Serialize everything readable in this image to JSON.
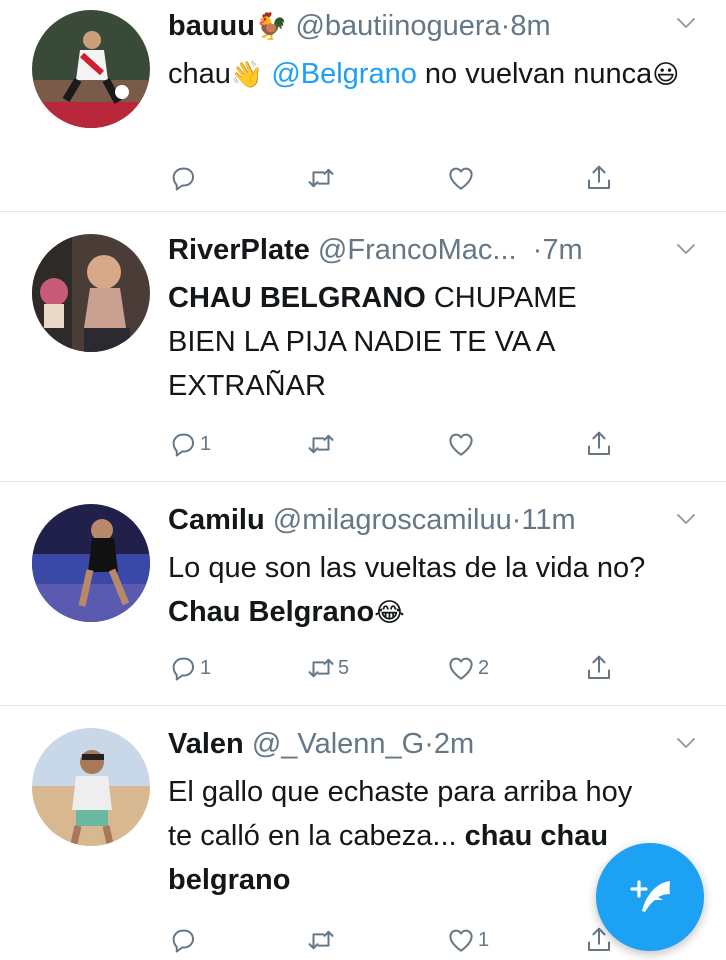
{
  "theme": {
    "accent": "#1da1f2",
    "secondary_text": "#657786",
    "divider": "#e1e8ed"
  },
  "tweets": [
    {
      "name": "bauuu",
      "name_emoji": "🐓",
      "handle": "@bautiinoguera",
      "sep": "·",
      "time": "8m",
      "text": {
        "p1": "chau",
        "emoji1": "👋",
        "mention": "@Belgrano",
        "p2": " no vuelvan nunca",
        "emoji2": "😃"
      },
      "counts": {
        "reply": "",
        "retweet": "",
        "like": ""
      }
    },
    {
      "name": "RiverPlate",
      "handle": "@FrancoMac...",
      "sep": "·",
      "time": "7m",
      "text": {
        "bold": "CHAU BELGRANO",
        "rest": " CHUPAME BIEN LA PIJA NADIE TE VA A EXTRAÑAR"
      },
      "counts": {
        "reply": "1",
        "retweet": "",
        "like": ""
      }
    },
    {
      "name": "Camilu",
      "handle": "@milagroscamiluu",
      "sep": "·",
      "time": "11m",
      "text": {
        "plain": "Lo que son las vueltas de la vida no? ",
        "bold": "Chau Belgrano",
        "emoji": "😂"
      },
      "counts": {
        "reply": "1",
        "retweet": "5",
        "like": "2"
      }
    },
    {
      "name": "Valen",
      "handle": "@_Valenn_G",
      "sep": "·",
      "time": "2m",
      "text": {
        "plain": "El gallo que echaste para arriba hoy te calló en la cabeza... ",
        "bold": "chau chau belgrano"
      },
      "counts": {
        "reply": "",
        "retweet": "",
        "like": "1"
      }
    }
  ],
  "icons": [
    "reply-icon",
    "retweet-icon",
    "like-icon",
    "share-icon",
    "caret-down-icon",
    "compose-tweet-icon"
  ]
}
